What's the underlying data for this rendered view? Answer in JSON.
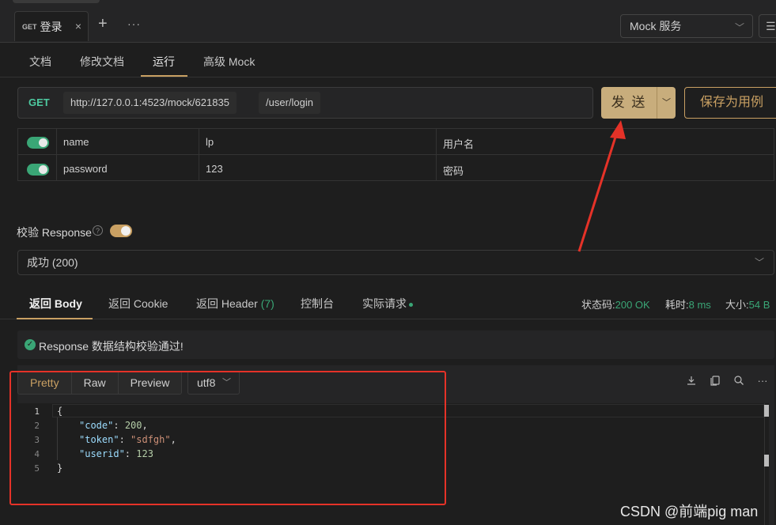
{
  "tabbar": {
    "tab": {
      "method": "GET",
      "title": "登录",
      "close": "×"
    },
    "add": "+",
    "more": "···",
    "mock_select": "Mock 服务",
    "list_icon": "☰"
  },
  "subtabs": [
    "文档",
    "修改文档",
    "运行",
    "高级 Mock"
  ],
  "request": {
    "method": "GET",
    "base_url": "http://127.0.0.1:4523/mock/621835",
    "path": "/user/login",
    "send_label": "发 送",
    "save_label": "保存为用例"
  },
  "params": [
    {
      "enabled": true,
      "name": "name",
      "value": "lp",
      "desc": "用户名"
    },
    {
      "enabled": true,
      "name": "password",
      "value": "123",
      "desc": "密码"
    }
  ],
  "validate": {
    "label": "校验 Response",
    "help": "?",
    "enabled": true,
    "selected_response": "成功 (200)"
  },
  "response_tabs": {
    "body": "返回 Body",
    "cookie": "返回 Cookie",
    "header": "返回 Header",
    "header_count": "(7)",
    "console": "控制台",
    "actual": "实际请求"
  },
  "response_stats": {
    "status_label": "状态码:",
    "status_value": "200 OK",
    "time_label": "耗时:",
    "time_value": "8 ms",
    "size_label": "大小:",
    "size_value": "54 B"
  },
  "validation_message": "Response 数据结构校验通过!",
  "body_toolbar": {
    "formats": [
      "Pretty",
      "Raw",
      "Preview"
    ],
    "active_format": "Pretty",
    "encoding": "utf8"
  },
  "code": {
    "line_numbers": [
      "1",
      "2",
      "3",
      "4",
      "5"
    ],
    "open_brace": "{",
    "close_brace": "}",
    "code_key": "\"code\"",
    "code_value": "200",
    "token_key": "\"token\"",
    "token_value": "\"sdfgh\"",
    "userid_key": "\"userid\"",
    "userid_value": "123"
  },
  "watermark": "CSDN @前端pig man",
  "colors": {
    "accent": "#c9a063",
    "success": "#3aa676",
    "annotation": "#e53228"
  }
}
